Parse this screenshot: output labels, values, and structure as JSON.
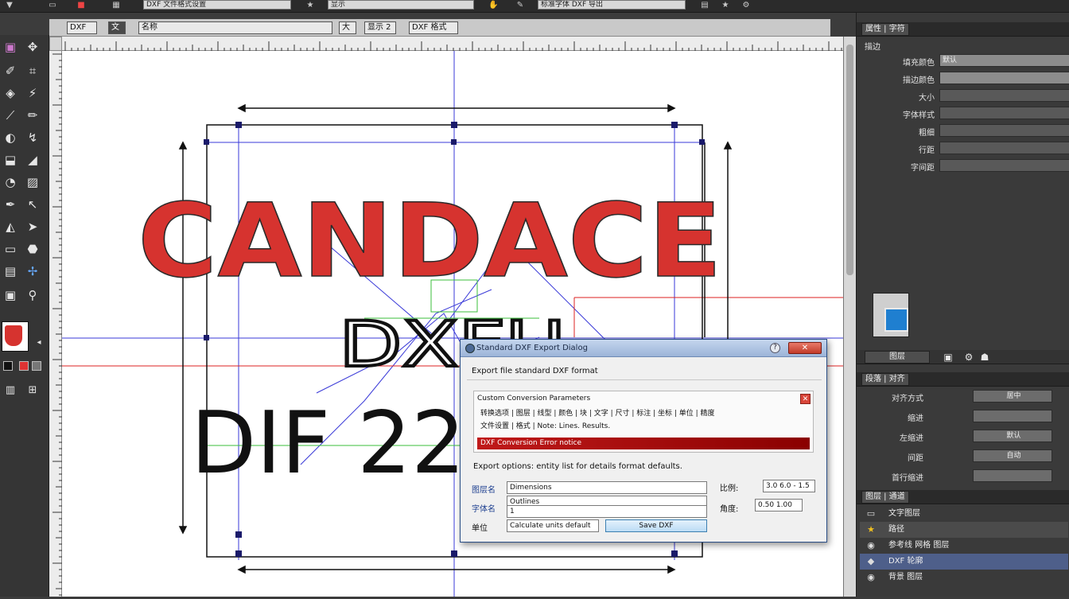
{
  "app": {
    "topbar": {
      "doc_field": "DXF 文件格式设置",
      "right_field": "标准字体 DXF 导出",
      "zoom_field": "显示"
    }
  },
  "options": {
    "chip1": "DXF 工具",
    "chip2": "文件",
    "name_field": "名称",
    "chip3": "大小",
    "chip4": "显示 2",
    "chip5": "DXF 格式"
  },
  "canvas": {
    "title_text": "CANDACE",
    "line2_text": "DXFU",
    "line3_text": "DIF 22"
  },
  "dialog": {
    "title": "Standard DXF Export Dialog",
    "close_label": "关闭",
    "intro": "Export file standard DXF format",
    "group_title": "Custom Conversion Parameters",
    "group_line1": "转换选项 | 图层 | 线型 | 颜色 | 块 | 文字 | 尺寸 | 标注 | 坐标 | 单位 | 精度",
    "group_line2": "文件设置 | 格式 | Note: Lines. Results.",
    "error_text": "DXF Conversion Error notice",
    "summary": "Export options: entity list for details format defaults.",
    "field1_label": "图层名",
    "field1_value": "Dimensions",
    "field2_label": "字体名",
    "field2_value": "Outlines",
    "field2b_value": "1",
    "field3_label": "单位",
    "field3_value": "Calculate units default",
    "primary_button": "Save DXF",
    "right_label1": "比例:",
    "right_value1": "3.0 6.0 - 1.5",
    "right_label2": "角度:",
    "right_value2": "0.50 1.00"
  },
  "panel": {
    "tab_properties": "属性 | 字符",
    "section_label": "描边",
    "rows": [
      {
        "label": "填充颜色",
        "value": "默认"
      },
      {
        "label": "描边颜色",
        "value": ""
      },
      {
        "label": "大小",
        "value": ""
      },
      {
        "label": "字体样式",
        "value": ""
      },
      {
        "label": "粗细",
        "value": ""
      },
      {
        "label": "行距",
        "value": ""
      },
      {
        "label": "字间距",
        "value": ""
      }
    ],
    "nav_label": "图层",
    "tab_character": "段落 | 对齐",
    "char_rows": [
      {
        "label": "对齐方式",
        "value": "居中"
      },
      {
        "label": "缩进",
        "value": ""
      },
      {
        "label": "左缩进",
        "value": "默认"
      },
      {
        "label": "间距",
        "value": "自动"
      },
      {
        "label": "首行缩进",
        "value": ""
      }
    ],
    "layers_tab": "图层 | 通道",
    "layers": [
      {
        "name": "文字图层",
        "icon": "layer-icon",
        "state": "normal"
      },
      {
        "name": "路径",
        "icon": "star-icon",
        "state": "hl"
      },
      {
        "name": "参考线 网格 图层",
        "icon": "eye-icon",
        "state": "normal"
      },
      {
        "name": "DXF 轮廓",
        "icon": "shape-icon",
        "state": "sel"
      },
      {
        "name": "背景 图层",
        "icon": "eye-icon",
        "state": "normal"
      }
    ]
  },
  "colors": {
    "title_red": "#d6332f",
    "guide_blue": "#3a3ad8",
    "dialog_accent": "#1c3e8f"
  }
}
